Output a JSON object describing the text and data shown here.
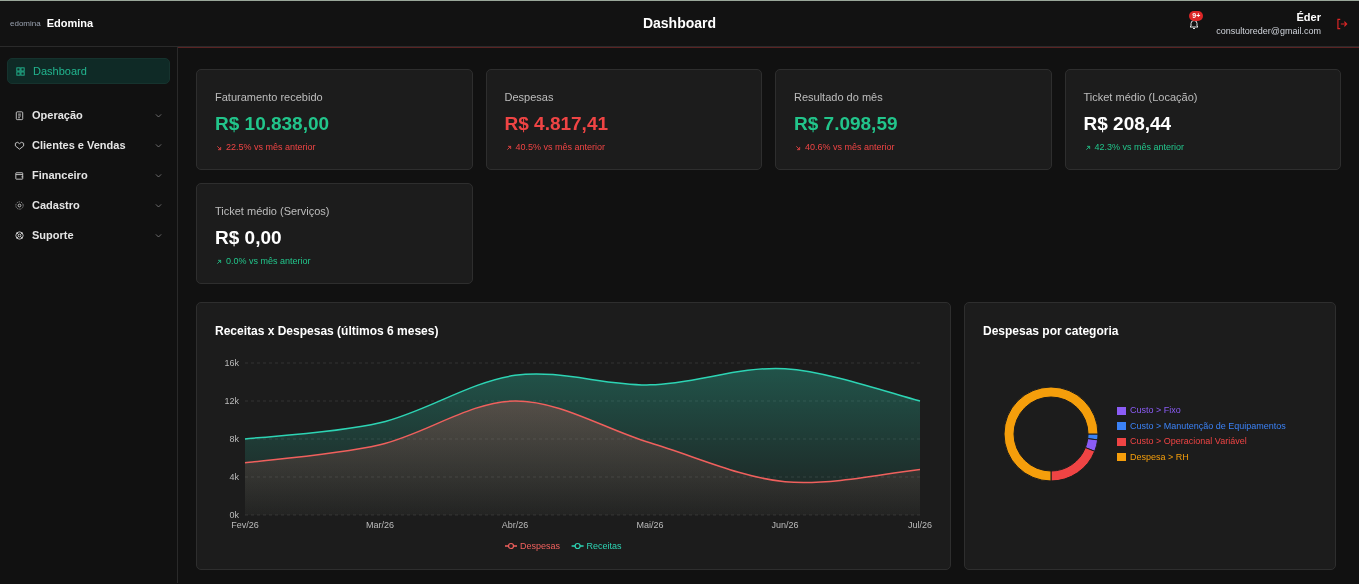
{
  "header": {
    "logo_small": "edomina",
    "brand": "Edomina",
    "title": "Dashboard",
    "notifications_badge": "9+",
    "user_name": "Éder",
    "user_email": "consultoreder@gmail.com"
  },
  "sidebar": {
    "items": [
      {
        "label": "Dashboard",
        "selected": true,
        "expandable": false
      },
      {
        "label": "Operação",
        "selected": false,
        "expandable": true
      },
      {
        "label": "Clientes e Vendas",
        "selected": false,
        "expandable": true
      },
      {
        "label": "Financeiro",
        "selected": false,
        "expandable": true
      },
      {
        "label": "Cadastro",
        "selected": false,
        "expandable": true
      },
      {
        "label": "Suporte",
        "selected": false,
        "expandable": true
      }
    ]
  },
  "kpis": [
    {
      "kind": "income",
      "label": "Faturamento recebido",
      "value": "R$ 10.838,00",
      "rising": false,
      "favorable": false,
      "delta": "22.5% vs mês anterior"
    },
    {
      "kind": "expense",
      "label": "Despesas",
      "value": "R$ 4.817,41",
      "rising": true,
      "favorable": false,
      "delta": "40.5% vs mês anterior"
    },
    {
      "kind": "income",
      "label": "Resultado do mês",
      "value": "R$ 7.098,59",
      "rising": false,
      "favorable": false,
      "delta": "40.6% vs mês anterior"
    },
    {
      "kind": "average",
      "label": "Ticket médio (Locação)",
      "value": "R$ 208,44",
      "rising": true,
      "favorable": true,
      "delta": "42.3% vs mês anterior"
    },
    {
      "kind": "average",
      "label": "Ticket médio (Serviços)",
      "value": "R$ 0,00",
      "rising": true,
      "favorable": true,
      "delta": "0.0% vs mês anterior"
    }
  ],
  "line_panel": {
    "chart_data": {
      "type": "area",
      "grid": true,
      "legend": "bottom",
      "title": "Receitas x Despesas (últimos 6 meses)",
      "categories": [
        "Fev/26",
        "Mar/26",
        "Abr/26",
        "Mai/26",
        "Jun/26",
        "Jul/26"
      ],
      "ylim": [
        0,
        16000
      ],
      "yticks": [
        {
          "value": 0,
          "label": "0k"
        },
        {
          "value": 4000,
          "label": "4k"
        },
        {
          "value": 8000,
          "label": "8k"
        },
        {
          "value": 12000,
          "label": "12k"
        },
        {
          "value": 16000,
          "label": "16k"
        }
      ],
      "series": [
        {
          "name": "Despesas",
          "color": "#f0605d",
          "values": [
            5500,
            7400,
            12000,
            7600,
            3500,
            4800
          ]
        },
        {
          "name": "Receitas",
          "color": "#2dd4b4",
          "values": [
            8000,
            9700,
            14700,
            13700,
            15400,
            12000
          ]
        }
      ]
    }
  },
  "donut_panel": {
    "chart_data": {
      "type": "donut",
      "legend": "right",
      "title": "Despesas por categoria",
      "categories": [
        "Custo > Fixo",
        "Custo > Manutenção de Equipamentos",
        "Custo > Operacional Variável",
        "Despesa > RH"
      ],
      "values": [
        4,
        2,
        19,
        75
      ],
      "colors": [
        "#8b5cf6",
        "#3b82f6",
        "#ef4444",
        "#f59e0b"
      ]
    }
  }
}
